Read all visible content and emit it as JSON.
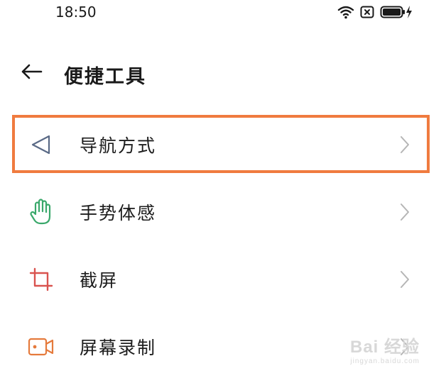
{
  "status_bar": {
    "time": "18:50",
    "icons": [
      "wifi-icon",
      "sim-disabled-icon",
      "battery-charging-icon"
    ]
  },
  "header": {
    "back_icon": "arrow-left-icon",
    "title": "便捷工具"
  },
  "list": {
    "items": [
      {
        "label": "导航方式",
        "icon": "navigation-triangle-icon",
        "icon_color": "#5a6a86",
        "highlighted": true
      },
      {
        "label": "手势体感",
        "icon": "hand-gesture-icon",
        "icon_color": "#3aa86b",
        "highlighted": false
      },
      {
        "label": "截屏",
        "icon": "crop-screenshot-icon",
        "icon_color": "#d9534f",
        "highlighted": false
      },
      {
        "label": "屏幕录制",
        "icon": "screen-record-icon",
        "icon_color": "#e57a3c",
        "highlighted": false
      }
    ]
  },
  "highlight_color": "#f07b3f",
  "watermark": {
    "main": "Bai 经验",
    "sub": "jingyan.baidu.com"
  }
}
